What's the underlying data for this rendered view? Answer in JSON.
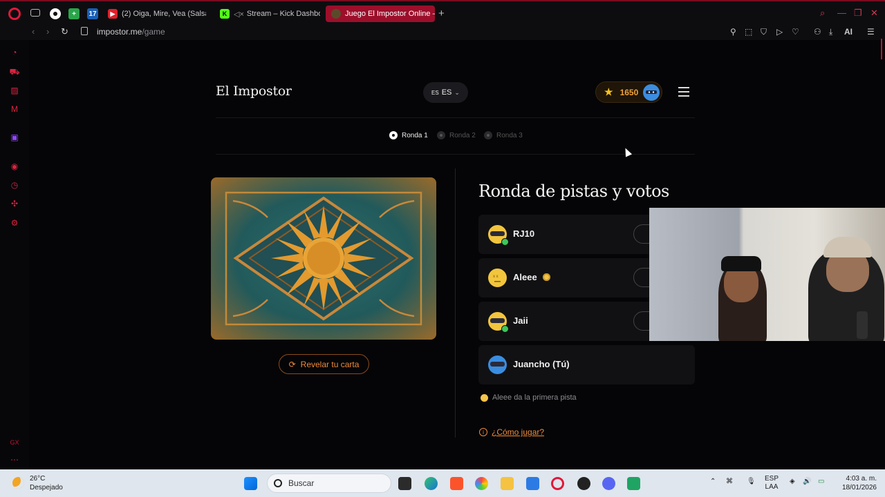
{
  "browser": {
    "tabs": [
      {
        "title": "(2) Oiga, Mire, Vea (Salsa)",
        "icon": "youtube-icon"
      },
      {
        "title": "Stream – Kick Dashboa",
        "icon": "kick-icon"
      },
      {
        "title": "Juego El Impostor Online –",
        "icon": "impostor-icon",
        "active": true
      }
    ],
    "pinned_labels": [
      "17"
    ],
    "url_host": "impostor.me",
    "url_path": "/game",
    "ai_label": "AI"
  },
  "app": {
    "brand": "El Impostor",
    "lang_flag": "ES",
    "lang_code": "ES",
    "score": "1650",
    "rounds": [
      {
        "label": "Ronda 1",
        "active": true
      },
      {
        "label": "Ronda 2",
        "active": false
      },
      {
        "label": "Ronda 3",
        "active": false
      }
    ],
    "reveal_label": "Revelar tu carta",
    "section_title": "Ronda de pistas y votos",
    "players": [
      {
        "name": "RJ10",
        "status": "checked",
        "face": "yellow-masked"
      },
      {
        "name": "Aleee",
        "status": "current-turn",
        "face": "yellow-dizzy"
      },
      {
        "name": "Jaii",
        "status": "checked",
        "face": "yellow-masked"
      },
      {
        "name": "Juancho (Tú)",
        "status": "self",
        "face": "blue-masked"
      }
    ],
    "hint": "Aleee da la primera pista",
    "how_to": "¿Cómo jugar?",
    "accent": "#f08a3a"
  },
  "taskbar": {
    "temp": "26°C",
    "weather": "Despejado",
    "search_placeholder": "Buscar",
    "lang_top": "ESP",
    "lang_bottom": "LAA",
    "time": "4:03 a. m.",
    "date": "18/01/2026"
  },
  "sidebar_footer": "GX"
}
